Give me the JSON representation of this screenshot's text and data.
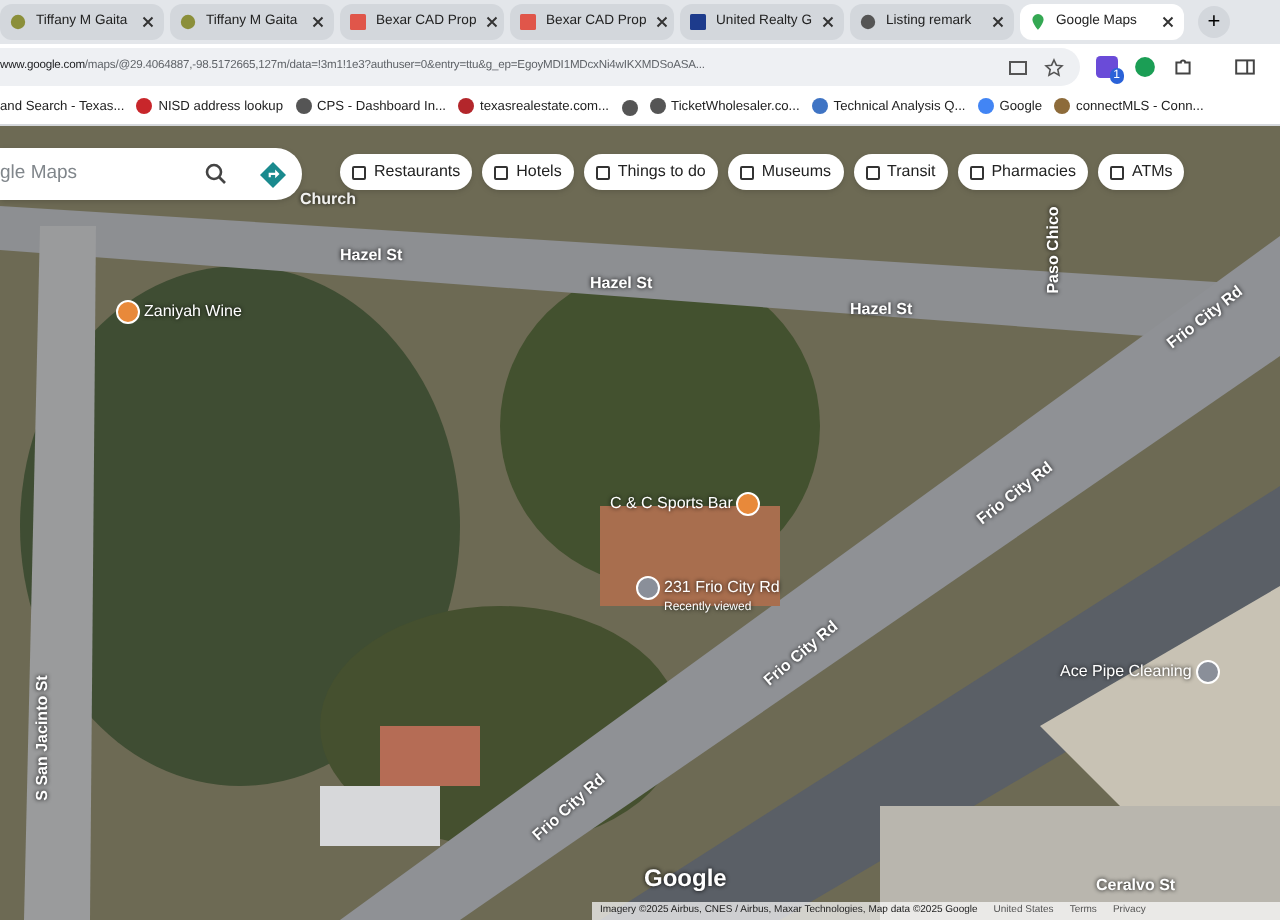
{
  "tabs": [
    {
      "title": "Tiffany M Gaita",
      "selected": false
    },
    {
      "title": "Tiffany M Gaita",
      "selected": false
    },
    {
      "title": "Bexar CAD Prop",
      "selected": false
    },
    {
      "title": "Bexar CAD Prop",
      "selected": false
    },
    {
      "title": "United Realty G",
      "selected": false
    },
    {
      "title": "Listing remark",
      "selected": false
    },
    {
      "title": "Google Maps",
      "selected": true
    }
  ],
  "new_tab": "+",
  "address_bar": {
    "host": "www.google.com",
    "path": "/maps/@29.4064887,-98.5172665,127m/data=!3m1!1e3?authuser=0&entry=ttu&g_ep=EgoyMDI1MDcxNi4wIKXMDSoASA..."
  },
  "extension_badge": "1",
  "bookmarks": [
    "and Search - Texas...",
    "NISD address lookup",
    "CPS - Dashboard In...",
    "texasrealestate.com...",
    "TicketWholesaler.co...",
    "Technical Analysis Q...",
    "Google",
    "connectMLS - Conn..."
  ],
  "map": {
    "search": {
      "placeholder": "gle Maps"
    },
    "chips": [
      "Restaurants",
      "Hotels",
      "Things to do",
      "Museums",
      "Transit",
      "Pharmacies",
      "ATMs"
    ],
    "labels": [
      {
        "kind": "place",
        "text": "Church"
      },
      {
        "kind": "street",
        "text": "Hazel St"
      },
      {
        "kind": "street",
        "text": "Hazel St"
      },
      {
        "kind": "street",
        "text": "Hazel St"
      },
      {
        "kind": "street",
        "text": "Paso Chico"
      },
      {
        "kind": "street",
        "text": "Frio City Rd"
      },
      {
        "kind": "street",
        "text": "Frio City Rd"
      },
      {
        "kind": "street",
        "text": "Frio City Rd"
      },
      {
        "kind": "street",
        "text": "Frio City Rd"
      },
      {
        "kind": "street",
        "text": "S San Jacinto St"
      },
      {
        "kind": "street",
        "text": "Ceralvo St"
      }
    ],
    "pins": [
      {
        "kind": "bar",
        "text": "Zaniyah Wine"
      },
      {
        "kind": "bar",
        "text": "C & C Sports Bar"
      },
      {
        "kind": "visited",
        "text": "231 Frio City Rd",
        "note": "Recently viewed"
      },
      {
        "kind": "business",
        "text": "Ace Pipe Cleaning"
      }
    ],
    "logo": "Google",
    "attribution": "Imagery ©2025 Airbus, CNES / Airbus, Maxar Technologies, Map data ©2025 Google",
    "footer_links": [
      "United States",
      "Terms",
      "Privacy"
    ]
  }
}
